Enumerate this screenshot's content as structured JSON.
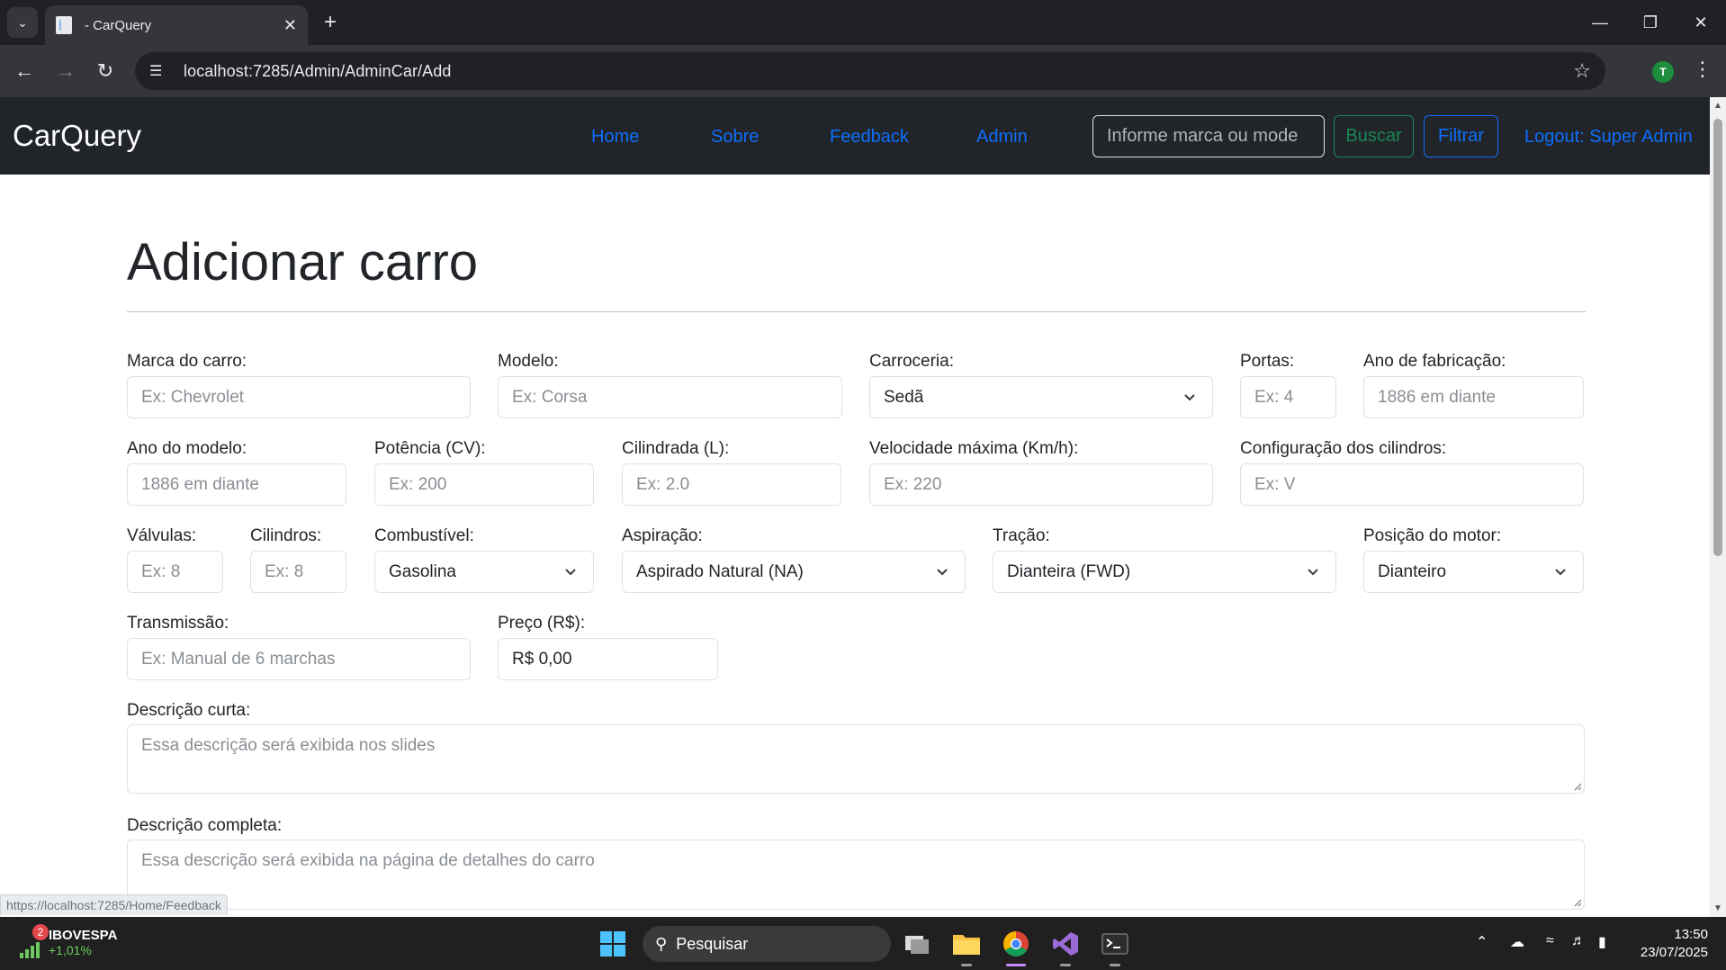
{
  "browser": {
    "tab_title": "- CarQuery",
    "url": "localhost:7285/Admin/AdminCar/Add",
    "profile_initial": "T",
    "status_url": "https://localhost:7285/Home/Feedback"
  },
  "nav": {
    "brand": "CarQuery",
    "links": [
      "Home",
      "Sobre",
      "Feedback",
      "Admin"
    ],
    "search_placeholder": "Informe marca ou mode",
    "search_button": "Buscar",
    "filter_button": "Filtrar",
    "logout": "Logout: Super Admin"
  },
  "page": {
    "title": "Adicionar carro"
  },
  "form": {
    "marca": {
      "label": "Marca do carro:",
      "placeholder": "Ex: Chevrolet"
    },
    "modelo": {
      "label": "Modelo:",
      "placeholder": "Ex: Corsa"
    },
    "carroceria": {
      "label": "Carroceria:",
      "value": "Sedã"
    },
    "portas": {
      "label": "Portas:",
      "placeholder": "Ex: 4"
    },
    "ano_fabricacao": {
      "label": "Ano de fabricação:",
      "placeholder": "1886 em diante"
    },
    "ano_modelo": {
      "label": "Ano do modelo:",
      "placeholder": "1886 em diante"
    },
    "potencia": {
      "label": "Potência (CV):",
      "placeholder": "Ex: 200"
    },
    "cilindrada": {
      "label": "Cilindrada (L):",
      "placeholder": "Ex: 2.0"
    },
    "velocidade": {
      "label": "Velocidade máxima (Km/h):",
      "placeholder": "Ex: 220"
    },
    "config_cilindros": {
      "label": "Configuração dos cilindros:",
      "placeholder": "Ex: V"
    },
    "valvulas": {
      "label": "Válvulas:",
      "placeholder": "Ex: 8"
    },
    "cilindros": {
      "label": "Cilindros:",
      "placeholder": "Ex: 8"
    },
    "combustivel": {
      "label": "Combustível:",
      "value": "Gasolina"
    },
    "aspiracao": {
      "label": "Aspiração:",
      "value": "Aspirado Natural (NA)"
    },
    "tracao": {
      "label": "Tração:",
      "value": "Dianteira (FWD)"
    },
    "posicao_motor": {
      "label": "Posição do motor:",
      "value": "Dianteiro"
    },
    "transmissao": {
      "label": "Transmissão:",
      "placeholder": "Ex: Manual de 6 marchas"
    },
    "preco": {
      "label": "Preço (R$):",
      "value": "R$ 0,00"
    },
    "descricao_curta": {
      "label": "Descrição curta:",
      "placeholder": "Essa descrição será exibida nos slides"
    },
    "descricao_completa": {
      "label": "Descrição completa:",
      "placeholder": "Essa descrição será exibida na página de detalhes do carro"
    }
  },
  "taskbar": {
    "stock_badge": "2",
    "stock_name": "IBOVESPA",
    "stock_change": "+1,01%",
    "search_label": "Pesquisar",
    "time": "13:50",
    "date": "23/07/2025"
  }
}
